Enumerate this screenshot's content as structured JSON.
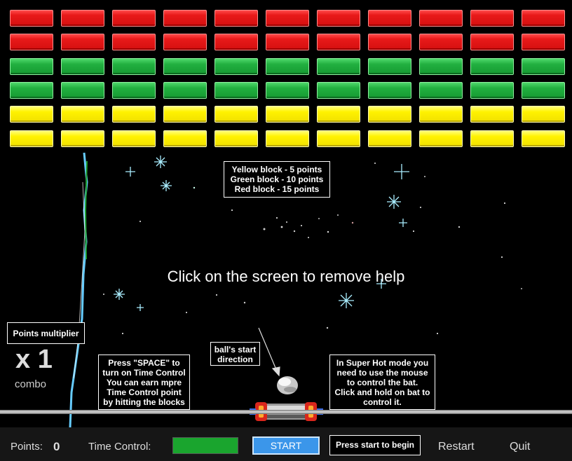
{
  "bricks": {
    "rows": [
      "red",
      "red",
      "green",
      "green",
      "yellow",
      "yellow"
    ],
    "columns": 11,
    "colors": {
      "red": "#e81a1a",
      "green": "#22b040",
      "yellow": "#fff200"
    }
  },
  "help": {
    "points_info": "Yellow block - 5 points\nGreen block - 10 points\nRed block - 15 points",
    "remove_hint": "Click on the screen to remove help",
    "multiplier_label": "Points multiplier",
    "time_control_info": "Press \"SPACE\" to turn on Time Control\nYou can earn mpre Time Control point by hitting the blocks",
    "ball_direction": "ball's start direction",
    "super_hot_info": "In Super Hot mode you need to use the mouse to control the bat.\nClick and hold on bat to control it."
  },
  "hud": {
    "multiplier_value": "x 1",
    "combo_label": "combo"
  },
  "bottom_bar": {
    "points_label": "Points:",
    "points_value": "0",
    "time_control_label": "Time Control:",
    "time_control_level": 1.0,
    "time_control_color": "#1aa52e",
    "start_label": "START",
    "start_color": "#3b96ea",
    "press_start_hint": "Press start to begin",
    "restart_label": "Restart",
    "quit_label": "Quit"
  }
}
